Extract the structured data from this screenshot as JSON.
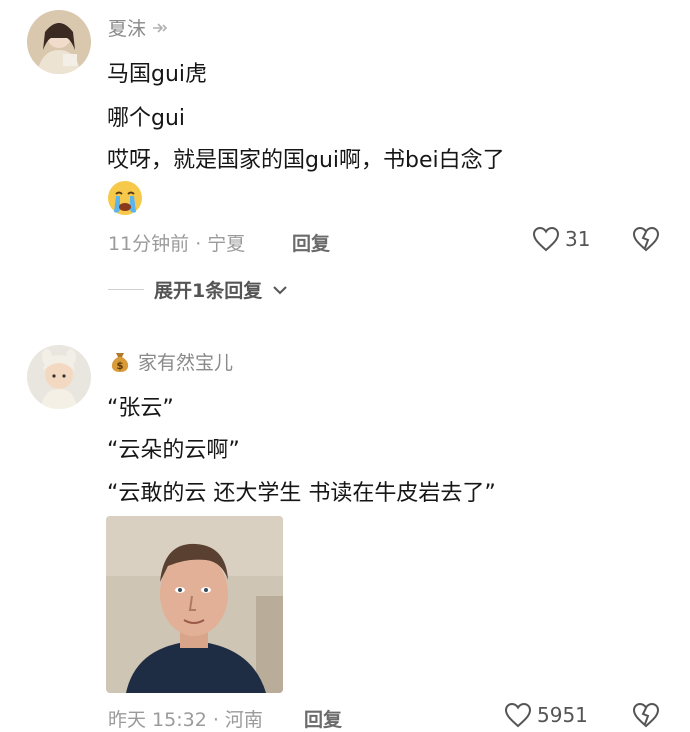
{
  "comments": [
    {
      "username": "夏沫",
      "lines": [
        "马国gui虎",
        "哪个gui",
        "哎呀，就是国家的国gui啊，书bei白念了"
      ],
      "time_location": "11分钟前 · 宁夏",
      "reply_label": "回复",
      "likes": "31",
      "expand_label": "展开1条回复"
    },
    {
      "username": "家有然宝儿",
      "lines": [
        "“张云”",
        "“云朵的云啊”",
        "“云敢的云 还大学生 书读在牛皮岩去了”"
      ],
      "time_location": "昨天 15:32 · 河南",
      "reply_label": "回复",
      "likes": "5951"
    }
  ],
  "icons": {
    "heart": "heart-outline-icon",
    "broken_heart": "broken-heart-icon",
    "chevron": "chevron-down-icon",
    "money_bag": "money-bag-icon",
    "cry_emoji": "crying-face-emoji"
  },
  "colors": {
    "text": "#161616",
    "muted": "#9b9b9b",
    "username": "#8a8a8a"
  }
}
